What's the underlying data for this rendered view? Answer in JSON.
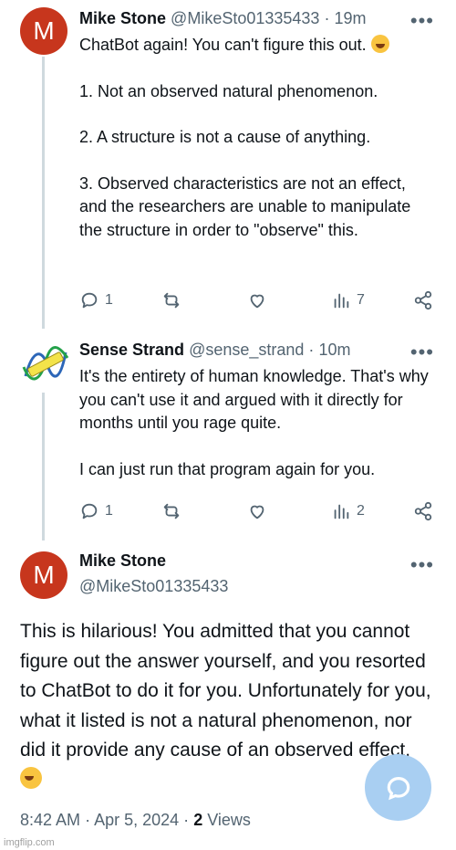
{
  "tweet1": {
    "avatar_letter": "M",
    "name": "Mike Stone",
    "handle": "@MikeSto01335433",
    "dot": "·",
    "time": "19m",
    "more": "•••",
    "lines": [
      "ChatBot again! You can't figure this out.",
      "1. Not an observed natural phenomenon.",
      "2. A structure is not a cause of anything.",
      "3. Observed characteristics are not an effect, and the researchers are unable to manipulate the structure in order to \"observe\" this."
    ],
    "replies": "1",
    "views": "7"
  },
  "tweet2": {
    "name": "Sense Strand",
    "handle": "@sense_strand",
    "dot": "·",
    "time": "10m",
    "more": "•••",
    "lines": [
      "It's the entirety of human knowledge. That's why you can't use it and argued with it directly for months until you rage quite.",
      "I can just run that program again for you."
    ],
    "replies": "1",
    "views": "2"
  },
  "main": {
    "avatar_letter": "M",
    "name": "Mike Stone",
    "handle": "@MikeSto01335433",
    "more": "•••",
    "text": "This is hilarious! You admitted that you cannot figure out the answer yourself, and you resorted to ChatBot to do it for you. Unfortunately for you, what it listed is not a natural phenomenon, nor did it provide any cause of an observed effect.",
    "time": "8:42 AM",
    "date": "Apr 5, 2024",
    "sep": "·",
    "views_count": "2",
    "views_label": "Views"
  },
  "icons": {
    "reply": "reply-icon",
    "retweet": "retweet-icon",
    "like": "heart-icon",
    "views": "analytics-icon",
    "share": "share-icon",
    "compose": "compose-reply-icon"
  },
  "watermark": "imgflip.com",
  "colors": {
    "avatar_bg": "#c7361d",
    "muted": "#536471",
    "thread_line": "#cfd9de",
    "fab": "#a9cff2"
  }
}
